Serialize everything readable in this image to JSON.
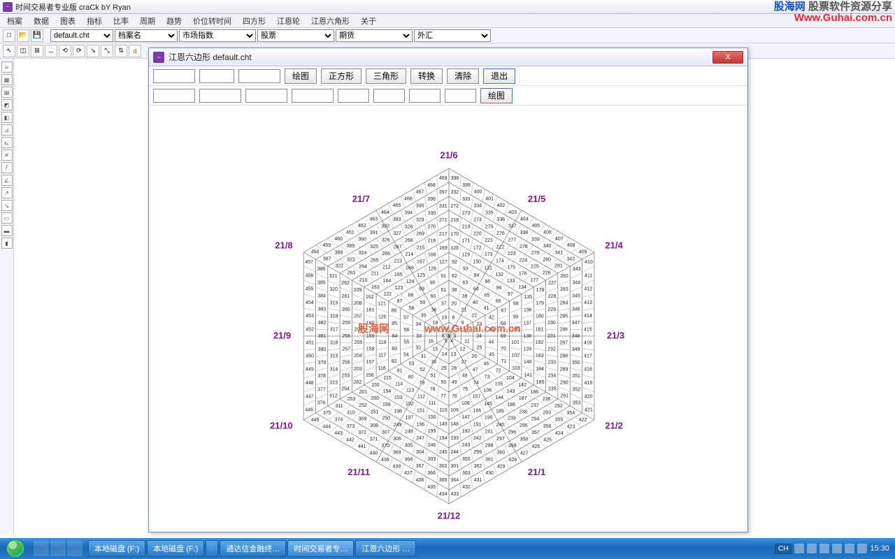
{
  "main": {
    "title": "时间交易者专业版  craCk bY Ryan",
    "menu": [
      "档案",
      "数据",
      "图表",
      "指标",
      "比率",
      "周期",
      "趋势",
      "价位转时间",
      "四方形",
      "江恩轮",
      "江恩六角形",
      "关于"
    ]
  },
  "toolbar1": {
    "file_sel": "default.cht",
    "drop1": "档案名",
    "drop2": "市场指数",
    "drop3": "股票",
    "drop4": "期货",
    "drop5": "外汇"
  },
  "watermark_top": {
    "cn1": "股海网",
    "cn2": "股票软件资源分享",
    "url": "Www.Guhai.com.cn"
  },
  "dialog": {
    "title": "江恩六边形   default.cht",
    "row1": {
      "b1": "绘图",
      "b2": "正方形",
      "b3": "三角形",
      "b4": "转换",
      "b5": "清除",
      "b6": "退出"
    },
    "row2": {
      "b1": "绘图"
    }
  },
  "hex": {
    "vlabels": [
      "21/6",
      "21/5",
      "21/4",
      "21/3",
      "21/2",
      "21/1",
      "21/12",
      "21/11",
      "21/10",
      "21/9",
      "21/8",
      "21/7"
    ],
    "wm_cn": "股海网",
    "wm_url": "www.Guhai.com.cn",
    "rings": 12
  },
  "taskbar": {
    "tasks": [
      {
        "label": "本地磁盘 (F:)"
      },
      {
        "label": "本地磁盘 (F:)"
      },
      {
        "label": ""
      },
      {
        "label": "通达信金融终…"
      },
      {
        "label": "时间交易者专…",
        "active": true
      },
      {
        "label": "江恩六边形 …"
      }
    ],
    "lang": "CH",
    "time": "15:30"
  }
}
